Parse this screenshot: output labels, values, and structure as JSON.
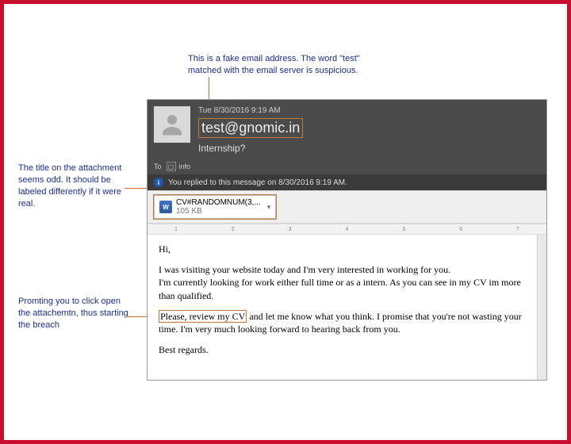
{
  "annotations": {
    "top": "This is a fake email address. The word \"test\" matched with the email server is suspicious.",
    "left1": "The title on the attachment seems odd. It should be labeled differently if it were real.",
    "left2": "Promting you to click open the attachemtn, thus starting the breach"
  },
  "header": {
    "timestamp": "Tue 8/30/2016 9:19 AM",
    "from": "test@gnomic.in",
    "subject": "Internship?",
    "to_label": "To",
    "info_label": "info",
    "reply_notice": "You replied to this message on 8/30/2016 9:19 AM."
  },
  "attachment": {
    "filename": "CV#RANDOMNUM(3,...",
    "size": "105 KB",
    "doc_badge": "W"
  },
  "ruler": {
    "marks": [
      "1",
      "2",
      "3",
      "4",
      "5",
      "6",
      "7"
    ]
  },
  "body": {
    "greeting": "Hi,",
    "p1": "I was visiting your website today and I'm very interested in working for you.",
    "p2": "I'm currently looking for work either full time or as a intern. As you can see in my CV im more than qualified.",
    "p3_hl": "Please, review my CV",
    "p3_rest": " and let me know what you think. I promise that you're not wasting your time. I'm very much looking forward to hearing back from you.",
    "closing": "Best regards."
  }
}
